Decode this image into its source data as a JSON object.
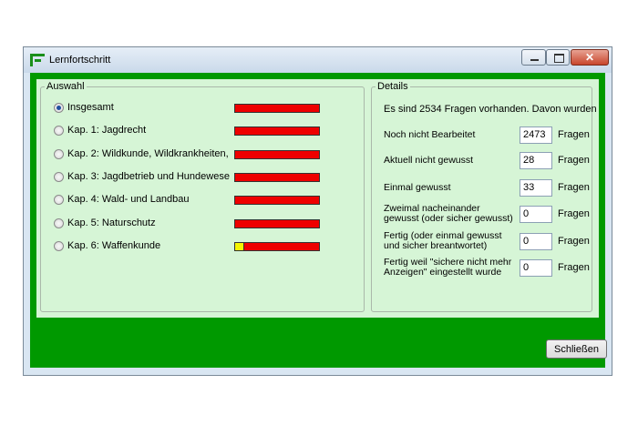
{
  "window": {
    "title": "Lernfortschritt"
  },
  "auswahl": {
    "legend": "Auswahl",
    "items": [
      {
        "label": "Insgesamt",
        "checked": true,
        "progress": 0.0
      },
      {
        "label": "Kap. 1: Jagdrecht",
        "checked": false,
        "progress": 0.0
      },
      {
        "label": "Kap. 2: Wildkunde, Wildkrankheiten,",
        "checked": false,
        "progress": 0.0
      },
      {
        "label": "Kap. 3: Jagdbetrieb und Hundewese",
        "checked": false,
        "progress": 0.0
      },
      {
        "label": "Kap. 4: Wald- und Landbau",
        "checked": false,
        "progress": 0.0
      },
      {
        "label": "Kap. 5: Naturschutz",
        "checked": false,
        "progress": 0.0
      },
      {
        "label": "Kap. 6: Waffenkunde",
        "checked": false,
        "progress": 0.1
      }
    ]
  },
  "details": {
    "legend": "Details",
    "intro": "Es sind 2534 Fragen vorhanden. Davon wurden",
    "rows": [
      {
        "label": "Noch nicht Bearbeitet",
        "value": "2473",
        "unit": "Fragen"
      },
      {
        "label": "Aktuell nicht gewusst",
        "value": "28",
        "unit": "Fragen"
      },
      {
        "label": "Einmal gewusst",
        "value": "33",
        "unit": "Fragen"
      },
      {
        "label": "Zweimal nacheinander gewusst (oder sicher gewusst)",
        "value": "0",
        "unit": "Fragen"
      },
      {
        "label": "Fertig (oder einmal gewusst und sicher breantwortet)",
        "value": "0",
        "unit": "Fragen"
      },
      {
        "label": "Fertig weil \"sichere nicht mehr Anzeigen\" eingestellt wurde",
        "value": "0",
        "unit": "Fragen"
      }
    ]
  },
  "buttons": {
    "close_label": "Schließen"
  },
  "colors": {
    "frame_green": "#009900",
    "panel_green": "#d6f5d6",
    "progress_empty": "#ee0000",
    "progress_done": "#f5f500"
  }
}
